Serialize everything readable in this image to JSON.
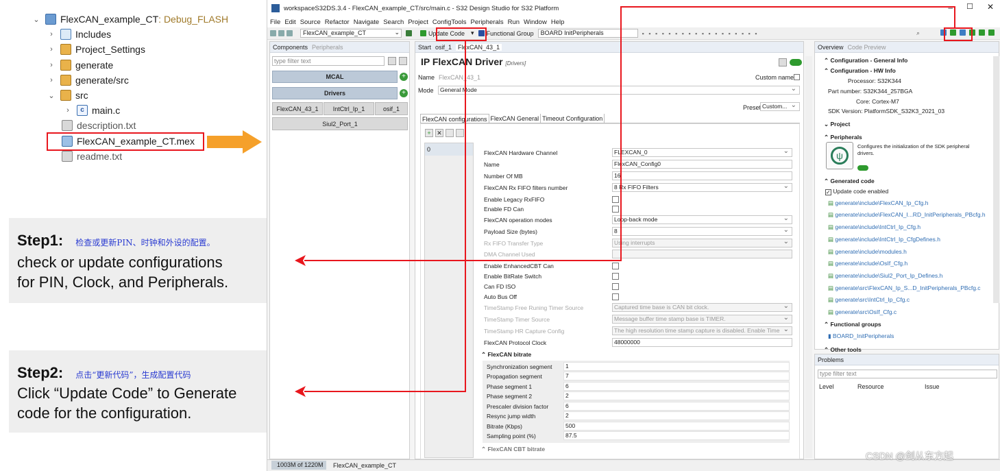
{
  "tree": {
    "project": "FlexCAN_example_CT",
    "project_config": ": Debug_FLASH",
    "items": [
      {
        "label": "Includes"
      },
      {
        "label": "Project_Settings"
      },
      {
        "label": "generate"
      },
      {
        "label": "generate/src"
      },
      {
        "label": "src"
      },
      {
        "label": "main.c"
      },
      {
        "label": "description.txt"
      },
      {
        "label": "FlexCAN_example_CT.mex"
      },
      {
        "label": "readme.txt"
      }
    ]
  },
  "steps": [
    {
      "title": "Step1:",
      "cn": "检查或更新PIN、时钟和外设的配置。",
      "body1": "check or update configurations",
      "body2": "for PIN, Clock, and Peripherals."
    },
    {
      "title": "Step2:",
      "cn": "点击“更新代码”，生成配置代码",
      "body1": "Click “Update Code” to Generate",
      "body2": "code for the configuration."
    }
  ],
  "ide": {
    "window_title": "workspaceS32DS.3.4 - FlexCAN_example_CT/src/main.c - S32 Design Studio for S32 Platform",
    "menu": [
      "File",
      "Edit",
      "Source",
      "Refactor",
      "Navigate",
      "Search",
      "Project",
      "ConfigTools",
      "Peripherals",
      "Run",
      "Window",
      "Help"
    ],
    "toolbar": {
      "project_select": "FlexCAN_example_CT",
      "update_code": "Update Code",
      "functional_group": "Functional Group",
      "functional_group_value": "BOARD InitPeripherals"
    },
    "components": {
      "tab1": "Components",
      "tab2": "Peripherals",
      "filter_placeholder": "type filter text",
      "mcal": "MCAL",
      "drivers": "Drivers",
      "drv1": "FlexCAN_43_1",
      "drv2": "IntCtrl_Ip_1",
      "drv3": "osif_1",
      "port": "Siul2_Port_1"
    },
    "editor": {
      "tabs": [
        "Start",
        "osif_1",
        "FlexCAN_43_1"
      ],
      "title": "IP FlexCAN Driver",
      "title_tag": "[Drivers]",
      "name_label": "Name",
      "name_value": "FlexCAN_43_1",
      "custom_name": "Custom name",
      "mode_label": "Mode",
      "mode_value": "General Mode",
      "preset_label": "Preset",
      "preset_value": "Custom...",
      "subtabs": [
        "FlexCAN configurations",
        "FlexCAN General",
        "Timeout Configuration"
      ],
      "list_index": "0",
      "fields": [
        {
          "label": "FlexCAN Hardware Channel",
          "value": "FLEXCAN_0",
          "type": "dd"
        },
        {
          "label": "Name",
          "value": "FlexCAN_Config0",
          "type": "text"
        },
        {
          "label": "Number Of MB",
          "value": "16",
          "type": "text"
        },
        {
          "label": "FlexCAN Rx FIFO filters number",
          "value": "8 Rx FIFO Filters",
          "type": "dd"
        },
        {
          "label": "Enable Legacy RxFIFO",
          "type": "cb"
        },
        {
          "label": "Enable FD Can",
          "type": "cb"
        },
        {
          "label": "FlexCAN operation modes",
          "value": "Loop-back mode",
          "type": "dd"
        },
        {
          "label": "Payload Size (bytes)",
          "value": "8",
          "type": "dd"
        },
        {
          "label": "Rx FIFO Transfer Type",
          "value": "Using interrupts",
          "type": "dd",
          "dis": true
        },
        {
          "label": "DMA Channel Used",
          "value": "",
          "type": "text",
          "dis": true
        },
        {
          "label": "Enable EnhancedCBT Can",
          "type": "cb"
        },
        {
          "label": "Enable BitRate Switch",
          "type": "cb"
        },
        {
          "label": "Can FD ISO",
          "type": "cb"
        },
        {
          "label": "Auto Bus Off",
          "type": "cb"
        },
        {
          "label": "TimeStamp Free Runing Timer Source",
          "value": "Captured time base is CAN bit clock.",
          "type": "dd",
          "dis": true
        },
        {
          "label": "TimeStamp Timer Source",
          "value": "Message buffer time stamp base is TIMER.",
          "type": "dd",
          "dis": true
        },
        {
          "label": "TimeStamp HR Capture Config",
          "value": "The high resolution time stamp capture is disabled. Enable Time",
          "type": "dd",
          "dis": true
        },
        {
          "label": "FlexCAN Protocol Clock",
          "value": "48000000",
          "type": "text"
        }
      ],
      "bitrate_title": "FlexCAN bitrate",
      "bitrate": [
        {
          "label": "Synchronization segment",
          "value": "1"
        },
        {
          "label": "Propagation segment",
          "value": "7"
        },
        {
          "label": "Phase segment 1",
          "value": "6"
        },
        {
          "label": "Phase segment 2",
          "value": "2"
        },
        {
          "label": "Prescaler division factor",
          "value": "6"
        },
        {
          "label": "Resync jump width",
          "value": "2"
        },
        {
          "label": "Bitrate (Kbps)",
          "value": "500"
        },
        {
          "label": "Sampling point (%)",
          "value": "87.5"
        }
      ],
      "cbt_title": "FlexCAN CBT bitrate"
    },
    "overview": {
      "tab1": "Overview",
      "tab2": "Code Preview",
      "sec_general": "Configuration - General Info",
      "sec_hw": "Configuration - HW Info",
      "processor": "Processor: S32K344",
      "part": "Part number: S32K344_257BGA",
      "core": "Core: Cortex-M7",
      "sdk": "SDK Version: PlatformSDK_S32K3_2021_03",
      "sec_project": "Project",
      "sec_periph": "Peripherals",
      "periph_desc1": "Configures the initialization of the SDK peripheral",
      "periph_desc2": "drivers.",
      "sec_gen": "Generated code",
      "update_enabled": "Update code enabled",
      "files": [
        "generate\\include\\FlexCAN_Ip_Cfg.h",
        "generate\\include\\FlexCAN_I...RD_InitPeripherals_PBcfg.h",
        "generate\\include\\IntCtrl_Ip_Cfg.h",
        "generate\\include\\IntCtrl_Ip_CfgDefines.h",
        "generate\\include\\modules.h",
        "generate\\include\\OsIf_Cfg.h",
        "generate\\include\\Siul2_Port_Ip_Defines.h",
        "generate\\src\\FlexCAN_Ip_S...D_InitPeripherals_PBcfg.c",
        "generate\\src\\IntCtrl_Ip_Cfg.c",
        "generate\\src\\OsIf_Cfg.c"
      ],
      "sec_func": "Functional groups",
      "func_item": "BOARD_InitPeripherals",
      "sec_other": "Other tools"
    },
    "problems": {
      "tab": "Problems",
      "filter": "type filter text",
      "col1": "Level",
      "col2": "Resource",
      "col3": "Issue"
    },
    "status": {
      "memory": "1003M of 1220M",
      "project": "FlexCAN_example_CT"
    },
    "watermark": "CSDN @剑从东方起"
  }
}
